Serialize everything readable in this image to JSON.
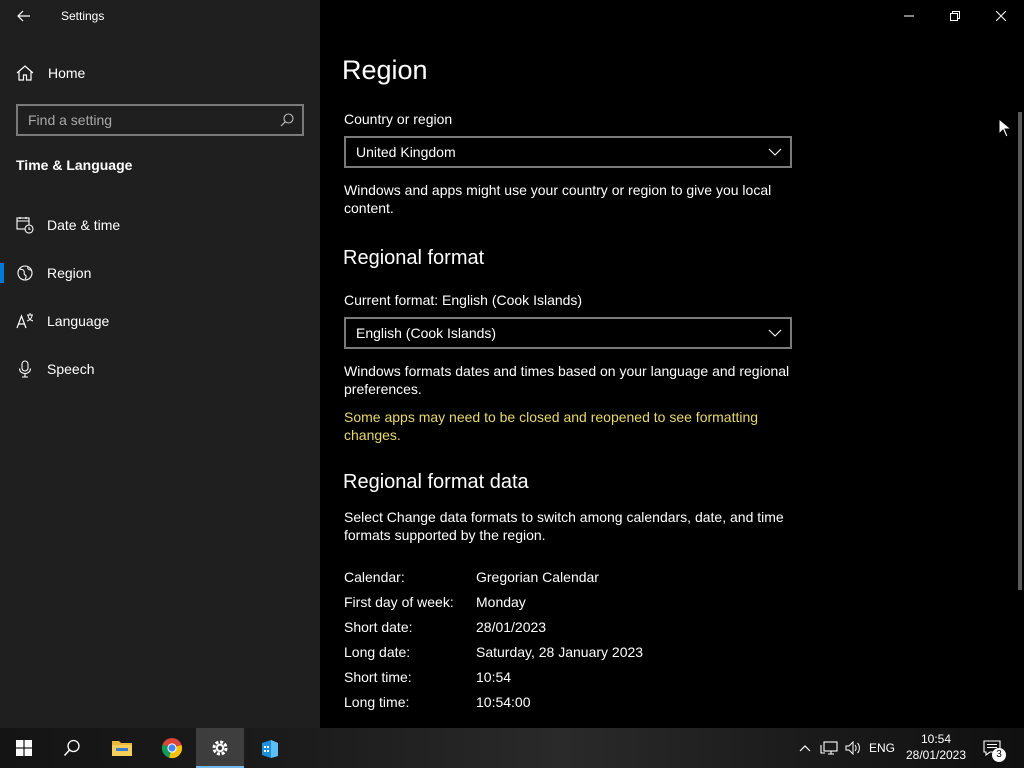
{
  "window": {
    "title": "Settings"
  },
  "sidebar": {
    "home_label": "Home",
    "search_placeholder": "Find a setting",
    "section_title": "Time & Language",
    "items": [
      {
        "label": "Date & time",
        "icon": "calendar-clock-icon"
      },
      {
        "label": "Region",
        "icon": "globe-icon",
        "selected": true
      },
      {
        "label": "Language",
        "icon": "language-icon"
      },
      {
        "label": "Speech",
        "icon": "microphone-icon"
      }
    ]
  },
  "main": {
    "title": "Region",
    "country_label": "Country or region",
    "country_value": "United Kingdom",
    "country_desc": "Windows and apps might use your country or region to give you local content.",
    "regional_format_heading": "Regional format",
    "current_format_label": "Current format: English (Cook Islands)",
    "format_value": "English (Cook Islands)",
    "format_desc": "Windows formats dates and times based on your language and regional preferences.",
    "format_warning": "Some apps may need to be closed and reopened to see formatting changes.",
    "format_data_heading": "Regional format data",
    "format_data_desc": "Select Change data formats to switch among calendars, date, and time formats supported by the region.",
    "format_data": [
      {
        "key": "Calendar:",
        "value": "Gregorian Calendar"
      },
      {
        "key": "First day of week:",
        "value": "Monday"
      },
      {
        "key": "Short date:",
        "value": "28/01/2023"
      },
      {
        "key": "Long date:",
        "value": "Saturday, 28 January 2023"
      },
      {
        "key": "Short time:",
        "value": "10:54"
      },
      {
        "key": "Long time:",
        "value": "10:54:00"
      }
    ]
  },
  "colors": {
    "accent": "#0078d7",
    "warning": "#e8d86a",
    "sidebar_bg": "#1f1f1f",
    "main_bg": "#000000"
  },
  "taskbar": {
    "apps": [
      "start-icon",
      "search-icon",
      "file-explorer-icon",
      "chrome-icon",
      "settings-icon",
      "store-icon"
    ],
    "language": "ENG",
    "time": "10:54",
    "date": "28/01/2023",
    "notification_count": "3"
  }
}
